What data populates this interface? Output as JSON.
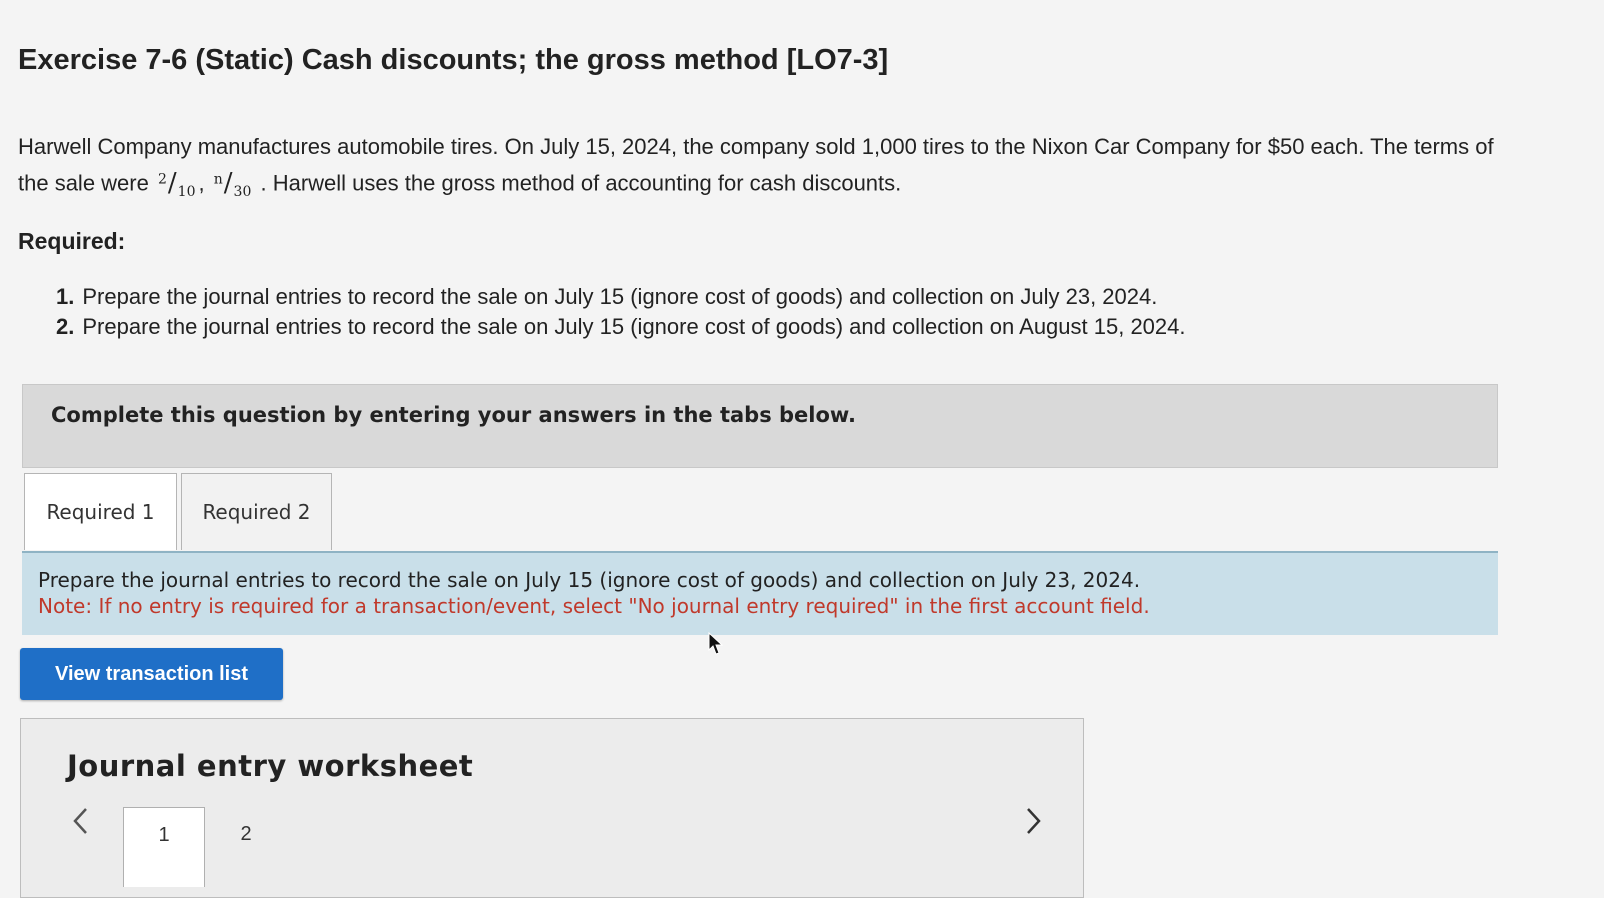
{
  "exercise": {
    "title": "Exercise 7-6 (Static) Cash discounts; the gross method [LO7-3]"
  },
  "intro": {
    "part1": "Harwell Company manufactures automobile tires. On July 15, 2024, the company sold 1,000 tires to the Nixon Car Company for $50 each. The terms of the sale were",
    "term1_num": "2",
    "term1_den": "10",
    "separator": ",",
    "term2_num": "n",
    "term2_den": "30",
    "part2": ". Harwell uses the gross method of accounting for cash discounts."
  },
  "required": {
    "heading": "Required:",
    "items": [
      {
        "num": "1.",
        "text": "Prepare the journal entries to record the sale on July 15 (ignore cost of goods) and collection on July 23, 2024."
      },
      {
        "num": "2.",
        "text": "Prepare the journal entries to record the sale on July 15 (ignore cost of goods) and collection on August 15, 2024."
      }
    ]
  },
  "instruction": "Complete this question by entering your answers in the tabs below.",
  "tabs": [
    {
      "label": "Required 1",
      "active": true
    },
    {
      "label": "Required 2",
      "active": false
    }
  ],
  "prompt": {
    "line1": "Prepare the journal entries to record the sale on July 15 (ignore cost of goods) and collection on July 23, 2024.",
    "line2": "Note: If no entry is required for a transaction/event, select \"No journal entry required\" in the first account field."
  },
  "view_button": "View transaction list",
  "worksheet": {
    "title": "Journal entry worksheet",
    "pages": [
      "1",
      "2"
    ],
    "active_page": "1"
  },
  "colors": {
    "button_blue": "#1f6fc7",
    "prompt_bg": "#c9dfe9",
    "note_red": "#c0392b",
    "instruction_bg": "#d9d9d9"
  }
}
